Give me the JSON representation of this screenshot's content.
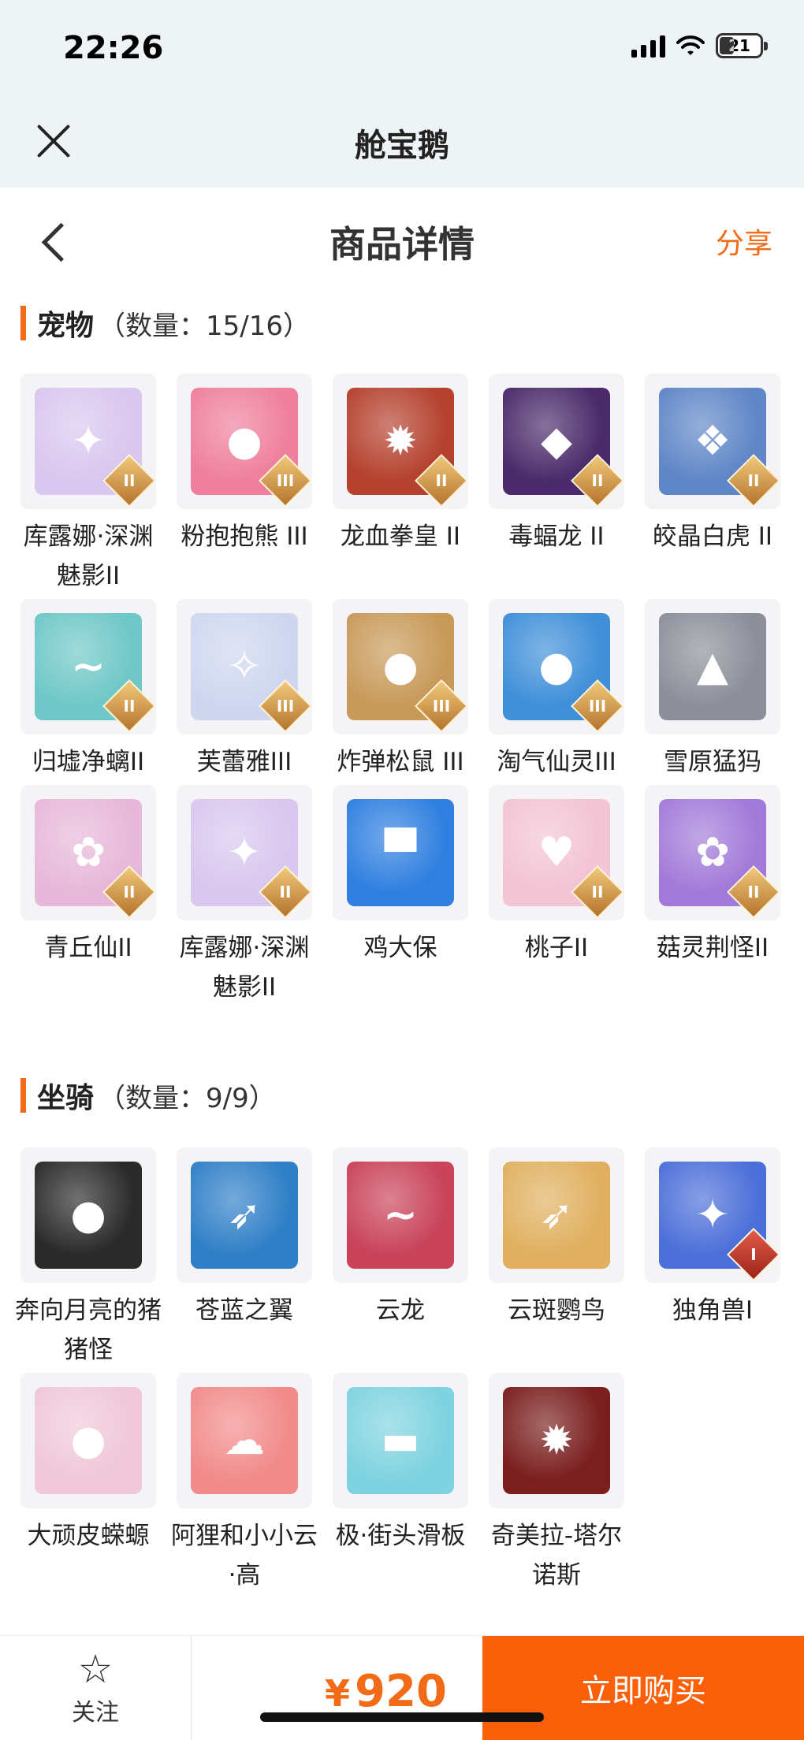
{
  "status_bar": {
    "time": "22:26",
    "battery": "21"
  },
  "miniapp": {
    "name": "舱宝鹅"
  },
  "nav": {
    "title": "商品详情",
    "share": "分享"
  },
  "pets": {
    "label": "宠物",
    "count": "（数量：15/16）",
    "items": [
      {
        "name": "库露娜·深渊魅影II",
        "badge": "II",
        "color": "#d9c7ef",
        "icon": "✦"
      },
      {
        "name": "粉抱抱熊 III",
        "badge": "III",
        "color": "#ef7f9d",
        "icon": "●"
      },
      {
        "name": "龙血拳皇 II",
        "badge": "II",
        "color": "#b5412e",
        "icon": "✹"
      },
      {
        "name": "毒蝠龙 II",
        "badge": "II",
        "color": "#4a2a6a",
        "icon": "◆"
      },
      {
        "name": "皎晶白虎 II",
        "badge": "II",
        "color": "#5f86c7",
        "icon": "❖"
      },
      {
        "name": "归墟净螭II",
        "badge": "II",
        "color": "#6fc7c7",
        "icon": "~"
      },
      {
        "name": "芙蕾雅III",
        "badge": "III",
        "color": "#cfd7ef",
        "icon": "✧"
      },
      {
        "name": "炸弹松鼠 III",
        "badge": "III",
        "color": "#c89a5a",
        "icon": "●"
      },
      {
        "name": "淘气仙灵III",
        "badge": "III",
        "color": "#3f8fd9",
        "icon": "●"
      },
      {
        "name": "雪原猛犸",
        "badge": "",
        "color": "#8c8f99",
        "icon": "▲"
      },
      {
        "name": "青丘仙II",
        "badge": "II",
        "color": "#e7b8d9",
        "icon": "✿"
      },
      {
        "name": "库露娜·深渊魅影II",
        "badge": "II",
        "color": "#d9c7ef",
        "icon": "✦"
      },
      {
        "name": "鸡大保",
        "badge": "",
        "color": "#2f7fe0",
        "icon": "▀"
      },
      {
        "name": "桃子II",
        "badge": "II",
        "color": "#f3c4d3",
        "icon": "♥"
      },
      {
        "name": "菇灵荆怪II",
        "badge": "II",
        "color": "#a27ad9",
        "icon": "✿"
      }
    ]
  },
  "mounts": {
    "label": "坐骑",
    "count": "（数量：9/9）",
    "items": [
      {
        "name": "奔向月亮的猪猪怪",
        "badge": "",
        "color": "#2a2a2a",
        "icon": "●"
      },
      {
        "name": "苍蓝之翼",
        "badge": "",
        "color": "#2f7fc7",
        "icon": "➶"
      },
      {
        "name": "云龙",
        "badge": "",
        "color": "#c9435a",
        "icon": "~"
      },
      {
        "name": "云斑鹦鸟",
        "badge": "",
        "color": "#e0b060",
        "icon": "➶"
      },
      {
        "name": "独角兽I",
        "badge": "I",
        "color": "#4c6fd9",
        "icon": "✦"
      },
      {
        "name": "大顽皮蝾螈",
        "badge": "",
        "color": "#f0c8d8",
        "icon": "●"
      },
      {
        "name": "阿狸和小小云·高",
        "badge": "",
        "color": "#f28b8b",
        "icon": "☁"
      },
      {
        "name": "极·街头滑板",
        "badge": "",
        "color": "#7fd3e0",
        "icon": "▬"
      },
      {
        "name": "奇美拉-塔尔诺斯",
        "badge": "",
        "color": "#7a1e1e",
        "icon": "✹"
      }
    ]
  },
  "bottom_bar": {
    "follow_label": "关注",
    "currency": "¥",
    "price": "920",
    "buy_label": "立即购买"
  },
  "colors": {
    "accent": "#f26b16",
    "buy": "#fa5f0a"
  }
}
